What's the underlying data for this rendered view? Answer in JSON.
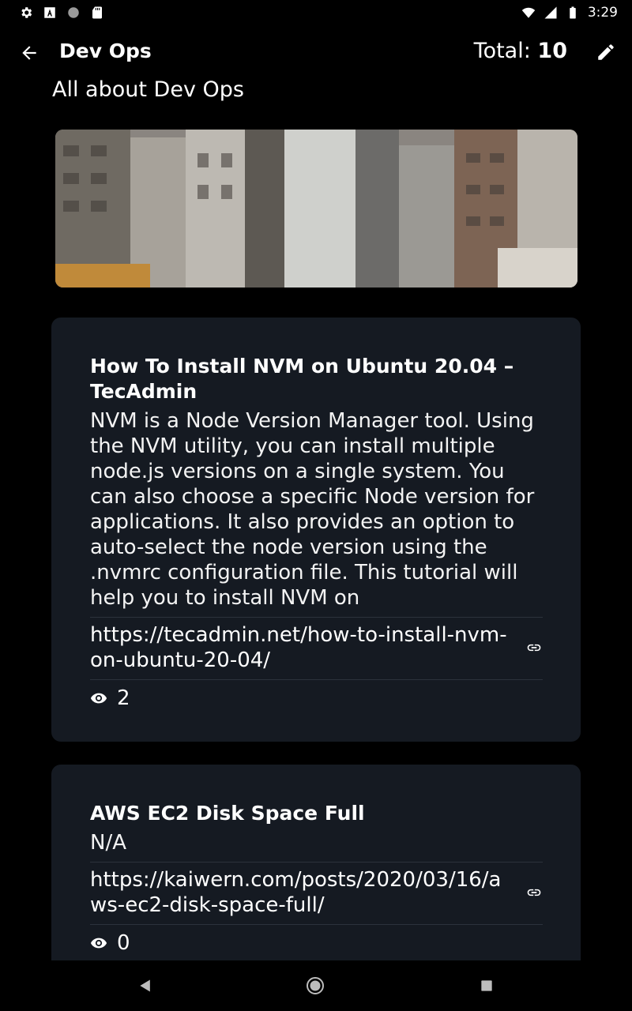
{
  "status_bar": {
    "time": "3:29",
    "left_icons": [
      "settings-icon",
      "font-a-icon",
      "circle-icon",
      "sd-card-icon"
    ],
    "right_icons": [
      "wifi-icon",
      "signal-icon",
      "battery-icon"
    ]
  },
  "app_bar": {
    "title": "Dev Ops",
    "total_label": "Total:",
    "total_value": "10",
    "back_icon": "arrow-left-icon",
    "edit_icon": "pencil-icon"
  },
  "subtitle": "All about Dev Ops",
  "hero_image": {
    "description_icon": "city-street-photo"
  },
  "cards": [
    {
      "title": "How To Install NVM on Ubuntu 20.04 – TecAdmin",
      "description": "NVM is a Node Version Manager tool. Using the NVM utility, you can install multiple node.js versions on a single system. You can also choose a specific Node version for applications. It also provides an option to auto-select the node version using the .nvmrc configuration file. This tutorial will help you to install NVM on",
      "url": "https://tecadmin.net/how-to-install-nvm-on-ubuntu-20-04/",
      "views": "2"
    },
    {
      "title": "AWS EC2 Disk Space Full",
      "description": "N/A",
      "url": "https://kaiwern.com/posts/2020/03/16/aws-ec2-disk-space-full/",
      "views": "0"
    }
  ],
  "nav_bar": {
    "icons": [
      "back-triangle-icon",
      "home-circle-icon",
      "recents-square-icon"
    ]
  },
  "colors": {
    "background": "#000000",
    "card": "#151a22",
    "divider": "#2c323c",
    "text": "#ffffff"
  }
}
